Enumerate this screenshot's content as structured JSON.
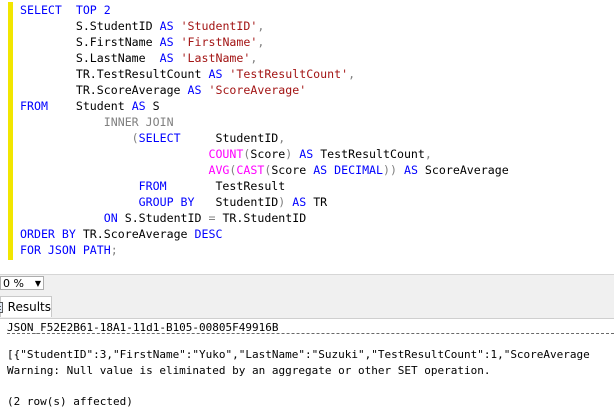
{
  "editor": {
    "lines": [
      [
        {
          "t": "SELECT  TOP 2",
          "c": "kw"
        }
      ],
      [
        {
          "t": "        S.StudentID ",
          "c": ""
        },
        {
          "t": "AS ",
          "c": "kw"
        },
        {
          "t": "'StudentID'",
          "c": "str"
        },
        {
          "t": ",",
          "c": "gr"
        }
      ],
      [
        {
          "t": "        S.FirstName ",
          "c": ""
        },
        {
          "t": "AS ",
          "c": "kw"
        },
        {
          "t": "'FirstName'",
          "c": "str"
        },
        {
          "t": ",",
          "c": "gr"
        }
      ],
      [
        {
          "t": "        S.LastName  ",
          "c": ""
        },
        {
          "t": "AS ",
          "c": "kw"
        },
        {
          "t": "'LastName'",
          "c": "str"
        },
        {
          "t": ",",
          "c": "gr"
        }
      ],
      [
        {
          "t": "        TR.TestResultCount ",
          "c": ""
        },
        {
          "t": "AS ",
          "c": "kw"
        },
        {
          "t": "'TestResultCount'",
          "c": "str"
        },
        {
          "t": ",",
          "c": "gr"
        }
      ],
      [
        {
          "t": "        TR.ScoreAverage ",
          "c": ""
        },
        {
          "t": "AS ",
          "c": "kw"
        },
        {
          "t": "'ScoreAverage'",
          "c": "str"
        }
      ],
      [
        {
          "t": "FROM",
          "c": "kw"
        },
        {
          "t": "    Student ",
          "c": ""
        },
        {
          "t": "AS ",
          "c": "kw"
        },
        {
          "t": "S",
          "c": ""
        }
      ],
      [
        {
          "t": "            INNER JOIN",
          "c": "gr"
        }
      ],
      [
        {
          "t": "                (",
          "c": "gr"
        },
        {
          "t": "SELECT",
          "c": "kw"
        },
        {
          "t": "     StudentID",
          "c": ""
        },
        {
          "t": ",",
          "c": "gr"
        }
      ],
      [
        {
          "t": "                           ",
          "c": ""
        },
        {
          "t": "COUNT",
          "c": "fn"
        },
        {
          "t": "(",
          "c": "gr"
        },
        {
          "t": "Score",
          "c": ""
        },
        {
          "t": ") ",
          "c": "gr"
        },
        {
          "t": "AS ",
          "c": "kw"
        },
        {
          "t": "TestResultCount",
          "c": ""
        },
        {
          "t": ",",
          "c": "gr"
        }
      ],
      [
        {
          "t": "                           ",
          "c": ""
        },
        {
          "t": "AVG",
          "c": "fn"
        },
        {
          "t": "(",
          "c": "gr"
        },
        {
          "t": "CAST",
          "c": "fn"
        },
        {
          "t": "(",
          "c": "gr"
        },
        {
          "t": "Score ",
          "c": ""
        },
        {
          "t": "AS DECIMAL",
          "c": "kw"
        },
        {
          "t": ")) ",
          "c": "gr"
        },
        {
          "t": "AS ",
          "c": "kw"
        },
        {
          "t": "ScoreAverage",
          "c": ""
        }
      ],
      [
        {
          "t": "                 ",
          "c": ""
        },
        {
          "t": "FROM",
          "c": "kw"
        },
        {
          "t": "       TestResult",
          "c": ""
        }
      ],
      [
        {
          "t": "                 ",
          "c": ""
        },
        {
          "t": "GROUP BY",
          "c": "kw"
        },
        {
          "t": "   StudentID",
          "c": ""
        },
        {
          "t": ") ",
          "c": "gr"
        },
        {
          "t": "AS ",
          "c": "kw"
        },
        {
          "t": "TR",
          "c": ""
        }
      ],
      [
        {
          "t": "            ",
          "c": ""
        },
        {
          "t": "ON ",
          "c": "kw"
        },
        {
          "t": "S.StudentID ",
          "c": ""
        },
        {
          "t": "= ",
          "c": "gr"
        },
        {
          "t": "TR.StudentID",
          "c": ""
        }
      ],
      [
        {
          "t": "ORDER BY ",
          "c": "kw"
        },
        {
          "t": "TR.ScoreAverage ",
          "c": ""
        },
        {
          "t": "DESC",
          "c": "kw"
        }
      ],
      [
        {
          "t": "FOR JSON PATH",
          "c": "kw"
        },
        {
          "t": ";",
          "c": "gr"
        }
      ]
    ]
  },
  "zoom": {
    "value": "0 %"
  },
  "tabs": {
    "results_label": "Results"
  },
  "results": {
    "column_header": "JSON_F52E2B61-18A1-11d1-B105-00805F49916B",
    "json_row": "[{\"StudentID\":3,\"FirstName\":\"Yuko\",\"LastName\":\"Suzuki\",\"TestResultCount\":1,\"ScoreAverage",
    "warning": "Warning: Null value is eliminated by an aggregate or other SET operation.",
    "rows_affected": "(2 row(s) affected)"
  },
  "colors": {
    "keyword": "#0000ff",
    "string": "#a31515",
    "function": "#ff00ff",
    "operator": "#808080",
    "change_bar": "#f2e600"
  }
}
